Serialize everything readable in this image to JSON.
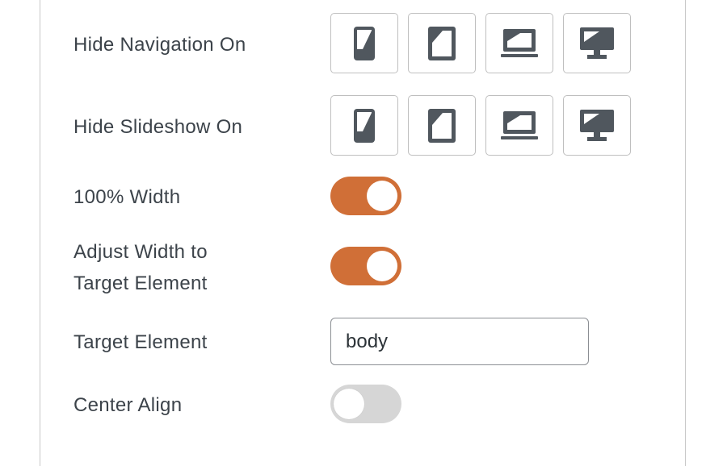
{
  "rows": {
    "hide_navigation": {
      "label": "Hide Navigation On",
      "devices": [
        "mobile-icon",
        "tablet-icon",
        "laptop-icon",
        "desktop-icon"
      ]
    },
    "hide_slideshow": {
      "label": "Hide Slideshow On",
      "devices": [
        "mobile-icon",
        "tablet-icon",
        "laptop-icon",
        "desktop-icon"
      ]
    },
    "full_width": {
      "label": "100% Width",
      "enabled": true
    },
    "adjust_width": {
      "label_line1": "Adjust Width to",
      "label_line2": "Target Element",
      "enabled": true
    },
    "target_element": {
      "label": "Target Element",
      "value": "body"
    },
    "center_align": {
      "label": "Center Align",
      "enabled": false
    }
  },
  "colors": {
    "toggle_on": "#d06f37",
    "toggle_off": "#d6d6d6",
    "icon": "#50575e",
    "label_text": "#3c434a"
  }
}
